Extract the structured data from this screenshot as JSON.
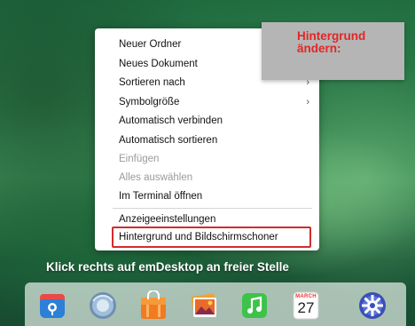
{
  "menu": {
    "items": [
      {
        "label": "Neuer Ordner",
        "disabled": false,
        "submenu": false
      },
      {
        "label": "Neues Dokument",
        "disabled": false,
        "submenu": false
      },
      {
        "label": "Sortieren nach",
        "disabled": false,
        "submenu": true
      },
      {
        "label": "Symbolgröße",
        "disabled": false,
        "submenu": true
      },
      {
        "label": "Automatisch verbinden",
        "disabled": false,
        "submenu": false
      },
      {
        "label": "Automatisch sortieren",
        "disabled": false,
        "submenu": false
      },
      {
        "label": "Einfügen",
        "disabled": true,
        "submenu": false
      },
      {
        "label": "Alles auswählen",
        "disabled": true,
        "submenu": false
      },
      {
        "label": "Im Terminal öffnen",
        "disabled": false,
        "submenu": false
      },
      {
        "label": "Anzeigeeinstellungen",
        "disabled": false,
        "submenu": false
      },
      {
        "label": "Hintergrund und Bildschirmschoner",
        "disabled": false,
        "submenu": false,
        "highlighted": true
      }
    ],
    "chevron": "›"
  },
  "callout": {
    "text": "Hintergrund\nändern:"
  },
  "caption": {
    "text": "Klick rechts auf emDesktop an freier Stelle"
  },
  "dock": {
    "calendar_month": "MARCH",
    "calendar_day": "27",
    "icons": [
      "file-manager-icon",
      "browser-icon",
      "app-store-icon",
      "photos-icon",
      "music-icon",
      "calendar-icon",
      "settings-icon"
    ]
  },
  "colors": {
    "accent_red": "#d22c2c",
    "callout_bg": "#b5b5b5"
  }
}
